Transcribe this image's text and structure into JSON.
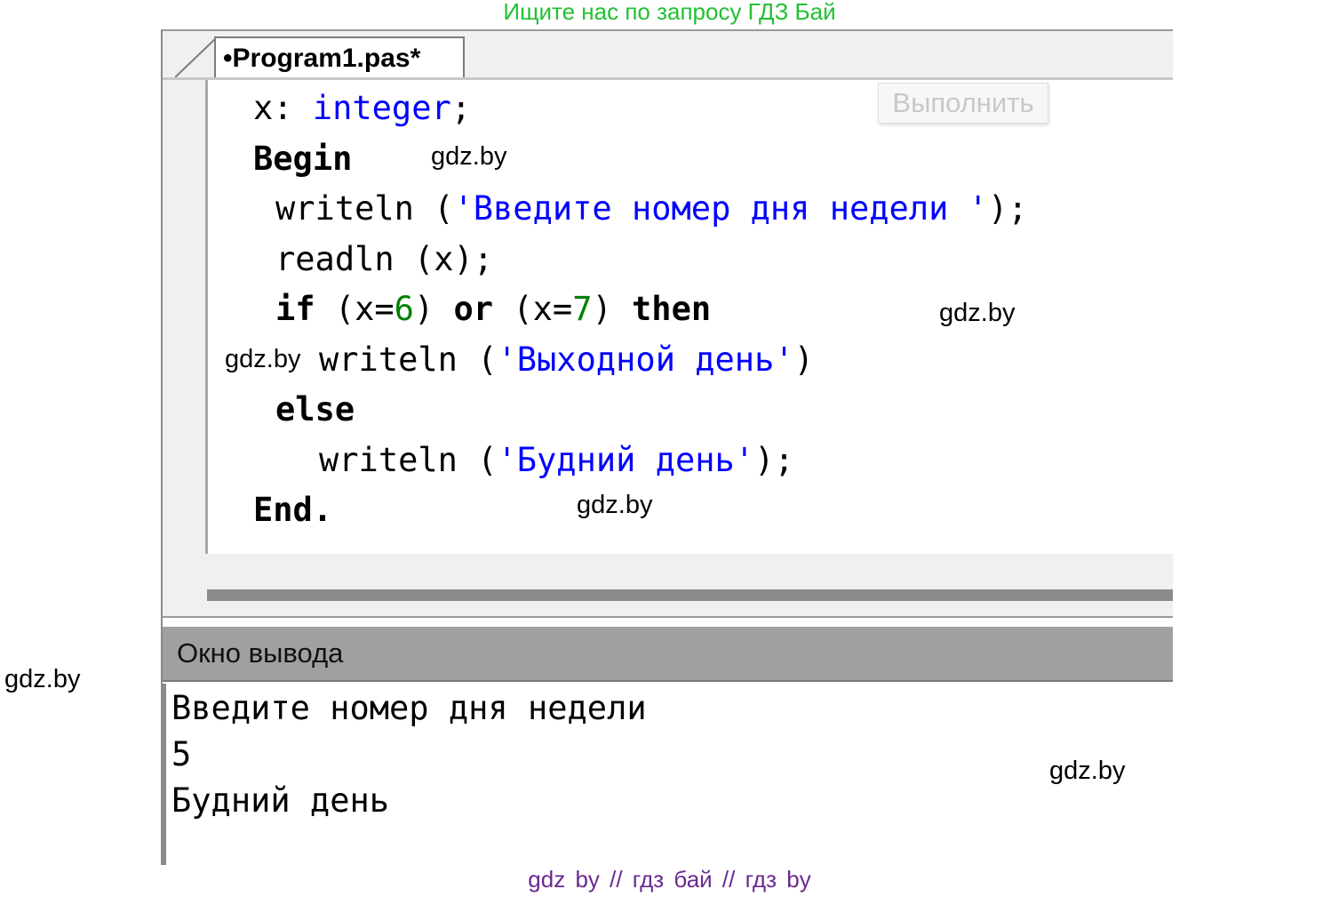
{
  "banner_top": "Ищите нас по запросу ГДЗ Бай",
  "banner_bottom": "gdz by  //  гдз бай  //  гдз by",
  "tab": {
    "label": "•Program1.pas*"
  },
  "run_button": {
    "label": "Выполнить"
  },
  "code": {
    "l1_var": "x: ",
    "l1_type": "integer",
    "l1_end": ";",
    "l2_kw": "Begin",
    "l3_a": "writeln (",
    "l3_str": "'Введите номер дня недели '",
    "l3_b": ");",
    "l4": "readln (x);",
    "l5_if": "if",
    "l5_a": " (x=",
    "l5_n1": "6",
    "l5_b": ") ",
    "l5_or": "or",
    "l5_c": " (x=",
    "l5_n2": "7",
    "l5_d": ") ",
    "l5_then": "then",
    "l6_a": "writeln (",
    "l6_str": "'Выходной день'",
    "l6_b": ")",
    "l7_kw": "else",
    "l8_a": "writeln (",
    "l8_str": "'Будний день'",
    "l8_b": ");",
    "l9_kw": "End."
  },
  "output": {
    "header": "Окно вывода",
    "lines": [
      "Введите номер дня недели",
      "5",
      "Будний день"
    ]
  },
  "watermarks": [
    "gdz.by",
    "gdz.by",
    "gdz.by",
    "gdz.by",
    "gdz.by",
    "gdz.by"
  ],
  "colors": {
    "keyword": "#000000",
    "type": "#0000ff",
    "string": "#0000ff",
    "number": "#008000",
    "banner_top": "#22c033",
    "banner_bottom": "#6a2a8f"
  }
}
